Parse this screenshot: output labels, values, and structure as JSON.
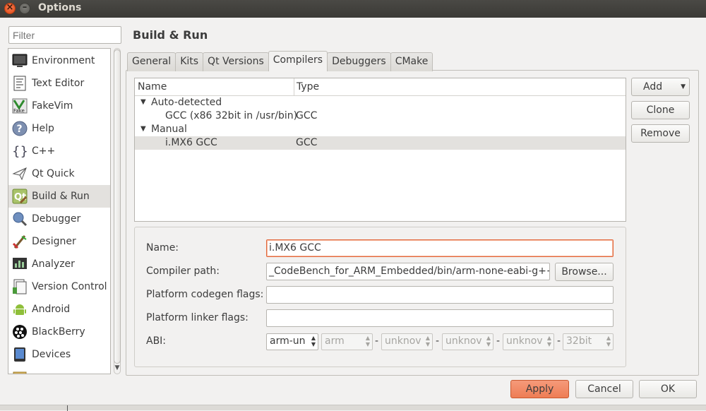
{
  "window": {
    "title": "Options"
  },
  "filter": {
    "placeholder": "Filter"
  },
  "categories": [
    {
      "label": "Environment",
      "icon": "monitor-icon"
    },
    {
      "label": "Text Editor",
      "icon": "text-editor-icon"
    },
    {
      "label": "FakeVim",
      "icon": "fakevim-icon"
    },
    {
      "label": "Help",
      "icon": "help-icon"
    },
    {
      "label": "C++",
      "icon": "cpp-braces-icon"
    },
    {
      "label": "Qt Quick",
      "icon": "qt-quick-plane-icon"
    },
    {
      "label": "Build & Run",
      "icon": "build-run-icon",
      "selected": true
    },
    {
      "label": "Debugger",
      "icon": "debugger-icon"
    },
    {
      "label": "Designer",
      "icon": "designer-brush-icon"
    },
    {
      "label": "Analyzer",
      "icon": "analyzer-icon"
    },
    {
      "label": "Version Control",
      "icon": "version-control-icon"
    },
    {
      "label": "Android",
      "icon": "android-icon"
    },
    {
      "label": "BlackBerry",
      "icon": "blackberry-icon"
    },
    {
      "label": "Devices",
      "icon": "devices-icon"
    }
  ],
  "page": {
    "title": "Build & Run"
  },
  "tabs": [
    {
      "label": "General"
    },
    {
      "label": "Kits"
    },
    {
      "label": "Qt Versions"
    },
    {
      "label": "Compilers",
      "active": true
    },
    {
      "label": "Debuggers"
    },
    {
      "label": "CMake"
    }
  ],
  "tree": {
    "columns": [
      "Name",
      "Type"
    ],
    "groups": [
      {
        "label": "Auto-detected",
        "items": [
          {
            "name": "GCC (x86 32bit in /usr/bin)",
            "type": "GCC"
          }
        ]
      },
      {
        "label": "Manual",
        "items": [
          {
            "name": "i.MX6 GCC",
            "type": "GCC",
            "selected": true
          }
        ]
      }
    ]
  },
  "side_buttons": {
    "add": "Add",
    "clone": "Clone",
    "remove": "Remove"
  },
  "details": {
    "name_label": "Name:",
    "name_value": "i.MX6 GCC",
    "path_label": "Compiler path:",
    "path_value": "_CodeBench_for_ARM_Embedded/bin/arm-none-eabi-g++",
    "browse_label": "Browse...",
    "codegen_label": "Platform codegen flags:",
    "codegen_value": "",
    "linker_label": "Platform linker flags:",
    "linker_value": "",
    "abi_label": "ABI:",
    "abi": [
      "arm-un",
      "arm",
      "unknov",
      "unknov",
      "unknov",
      "32bit"
    ],
    "abi_separator": "-"
  },
  "footer": {
    "apply": "Apply",
    "cancel": "Cancel",
    "ok": "OK"
  },
  "colors": {
    "accent": "#ee7d55",
    "focus_border": "#e2683c",
    "selection": "#e3e1de"
  }
}
